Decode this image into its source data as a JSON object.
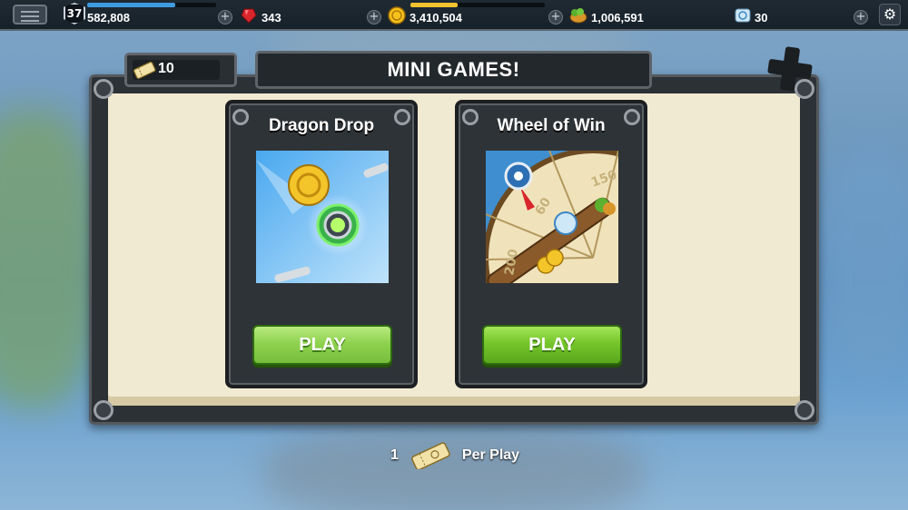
{
  "topbar": {
    "level": "37",
    "xp_value": "582,808",
    "xp_fill_fraction": 0.68,
    "gems": "343",
    "gold": "3,410,504",
    "gold_fill_fraction": 0.35,
    "food": "1,006,591",
    "shards": "30",
    "plus_symbol": "+",
    "settings_glyph": "⚙"
  },
  "panel": {
    "title": "MINI GAMES!",
    "ticket_count": "10"
  },
  "cards": [
    {
      "title": "Dragon Drop",
      "play_label": "PLAY",
      "image_icon": "dragon-drop-art"
    },
    {
      "title": "Wheel of Win",
      "play_label": "PLAY",
      "image_icon": "wheel-of-win-art",
      "wheel_labels": [
        "60",
        "150",
        "200"
      ]
    }
  ],
  "footer": {
    "cost": "1",
    "per_play_label": "Per Play"
  },
  "colors": {
    "play_green": "#76c52b",
    "xp_blue": "#3f9be0",
    "gold_yellow": "#f2c230",
    "panel_cream": "#f1ead2"
  }
}
